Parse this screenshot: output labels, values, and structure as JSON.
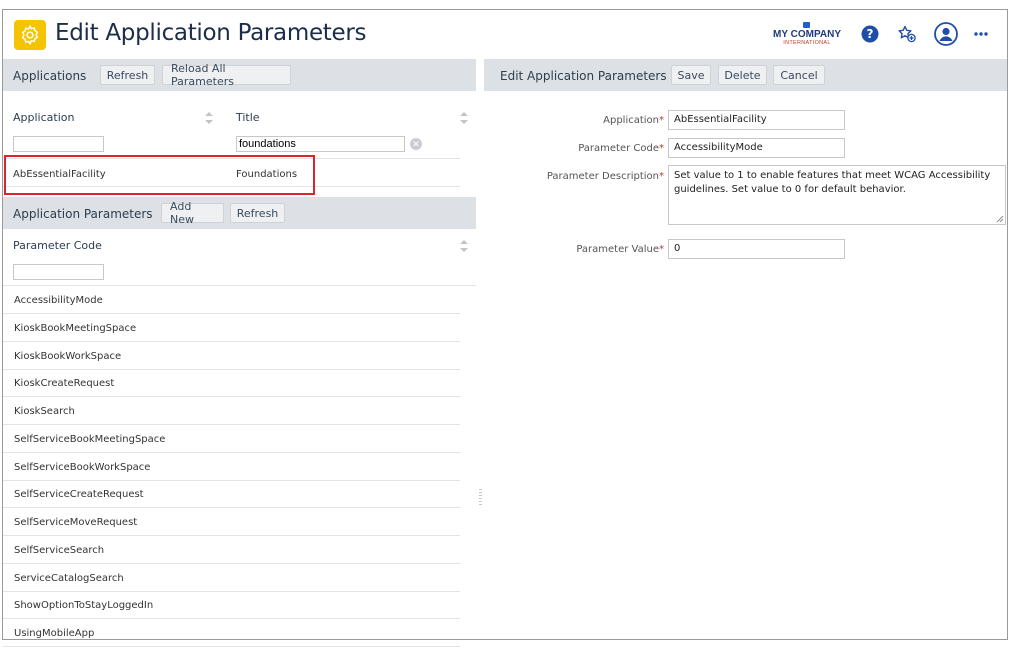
{
  "header": {
    "title": "Edit Application Parameters",
    "logo_name": "MY COMPANY",
    "logo_sub": "INTERNATIONAL",
    "icons": [
      "help-icon",
      "favorite-add-icon",
      "user-avatar-icon",
      "more-icon"
    ],
    "accent_color": "#f5c400"
  },
  "applications_panel": {
    "title": "Applications",
    "refresh_label": "Refresh",
    "reload_label": "Reload All Parameters",
    "columns": [
      "Application",
      "Title"
    ],
    "filters": {
      "application": "",
      "title": "foundations"
    },
    "rows": [
      {
        "application": "AbEssentialFacility",
        "title": "Foundations",
        "selected": true
      }
    ]
  },
  "parameters_panel": {
    "title": "Application Parameters",
    "add_new_label": "Add New",
    "refresh_label": "Refresh",
    "column": "Parameter Code",
    "filter": "",
    "rows": [
      "AccessibilityMode",
      "KioskBookMeetingSpace",
      "KioskBookWorkSpace",
      "KioskCreateRequest",
      "KioskSearch",
      "SelfServiceBookMeetingSpace",
      "SelfServiceBookWorkSpace",
      "SelfServiceCreateRequest",
      "SelfServiceMoveRequest",
      "SelfServiceSearch",
      "ServiceCatalogSearch",
      "ShowOptionToStayLoggedIn",
      "UsingMobileApp"
    ]
  },
  "edit_panel": {
    "title": "Edit Application Parameters",
    "save_label": "Save",
    "delete_label": "Delete",
    "cancel_label": "Cancel",
    "fields": {
      "application": {
        "label": "Application",
        "value": "AbEssentialFacility"
      },
      "parameter_code": {
        "label": "Parameter Code",
        "value": "AccessibilityMode"
      },
      "parameter_description": {
        "label": "Parameter Description",
        "value": "Set value to 1 to enable features that meet WCAG Accessibility guidelines.  Set value to 0 for default behavior."
      },
      "parameter_value": {
        "label": "Parameter Value",
        "value": "0"
      }
    },
    "required_marker": "*"
  }
}
